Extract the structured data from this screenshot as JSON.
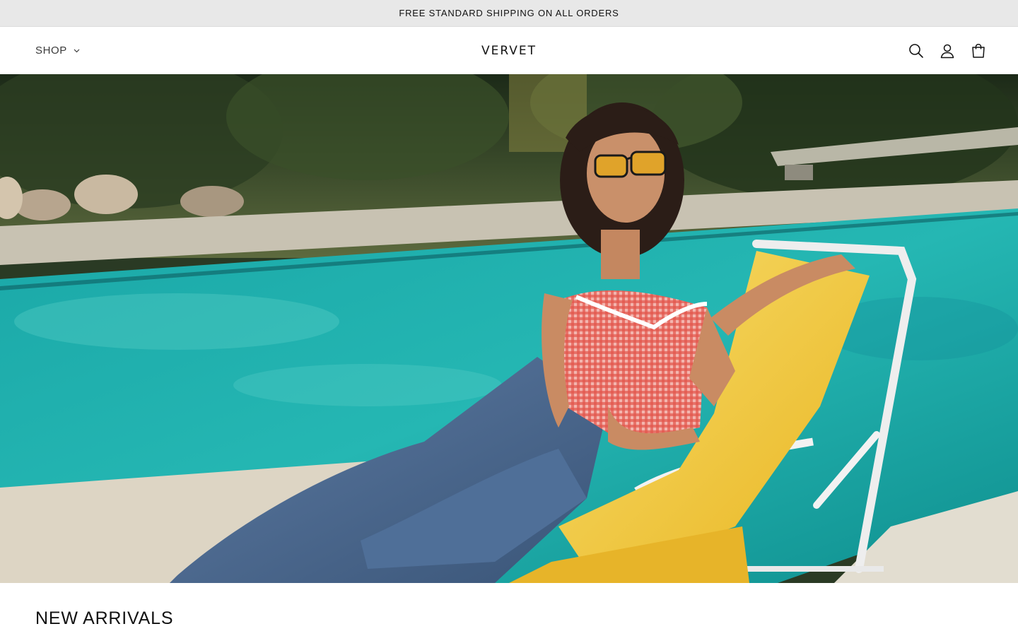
{
  "announcement": {
    "text": "FREE STANDARD SHIPPING ON ALL ORDERS"
  },
  "header": {
    "shop_label": "SHOP",
    "brand": "VERVET",
    "icons": [
      "search-icon",
      "account-icon",
      "cart-icon"
    ]
  },
  "hero": {
    "image": "woman-lounging-by-pool"
  },
  "sections": {
    "new_arrivals_title": "NEW ARRIVALS"
  },
  "colors": {
    "announcement_bg": "#e8e8e8",
    "text": "#121212",
    "pool": "#1faaa6",
    "cushion": "#f2c93a"
  }
}
